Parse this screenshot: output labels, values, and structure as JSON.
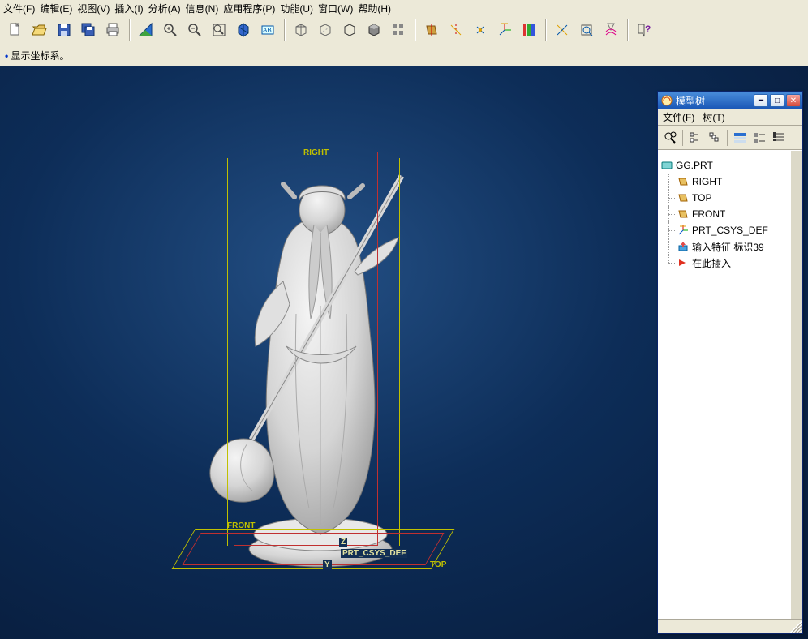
{
  "menu": {
    "file": "文件(F)",
    "edit": "编辑(E)",
    "view": "视图(V)",
    "insert": "插入(I)",
    "analysis": "分析(A)",
    "info": "信息(N)",
    "app": "应用程序(P)",
    "func": "功能(U)",
    "window": "窗口(W)",
    "help": "帮助(H)"
  },
  "status": "显示坐标系。",
  "viewport_labels": {
    "right": "RIGHT",
    "front": "FRONT",
    "top": "TOP",
    "csys": "PRT_CSYS_DEF",
    "z": "Z",
    "y": "Y"
  },
  "panel": {
    "title": "模型树",
    "menu": {
      "file": "文件(F)",
      "tree": "树(T)"
    },
    "tree": {
      "root": "GG.PRT",
      "items": [
        {
          "label": "RIGHT",
          "icon": "datum"
        },
        {
          "label": "TOP",
          "icon": "datum"
        },
        {
          "label": "FRONT",
          "icon": "datum"
        },
        {
          "label": "PRT_CSYS_DEF",
          "icon": "csys"
        },
        {
          "label": "输入特征 标识39",
          "icon": "import"
        },
        {
          "label": "在此插入",
          "icon": "insert"
        }
      ]
    }
  }
}
